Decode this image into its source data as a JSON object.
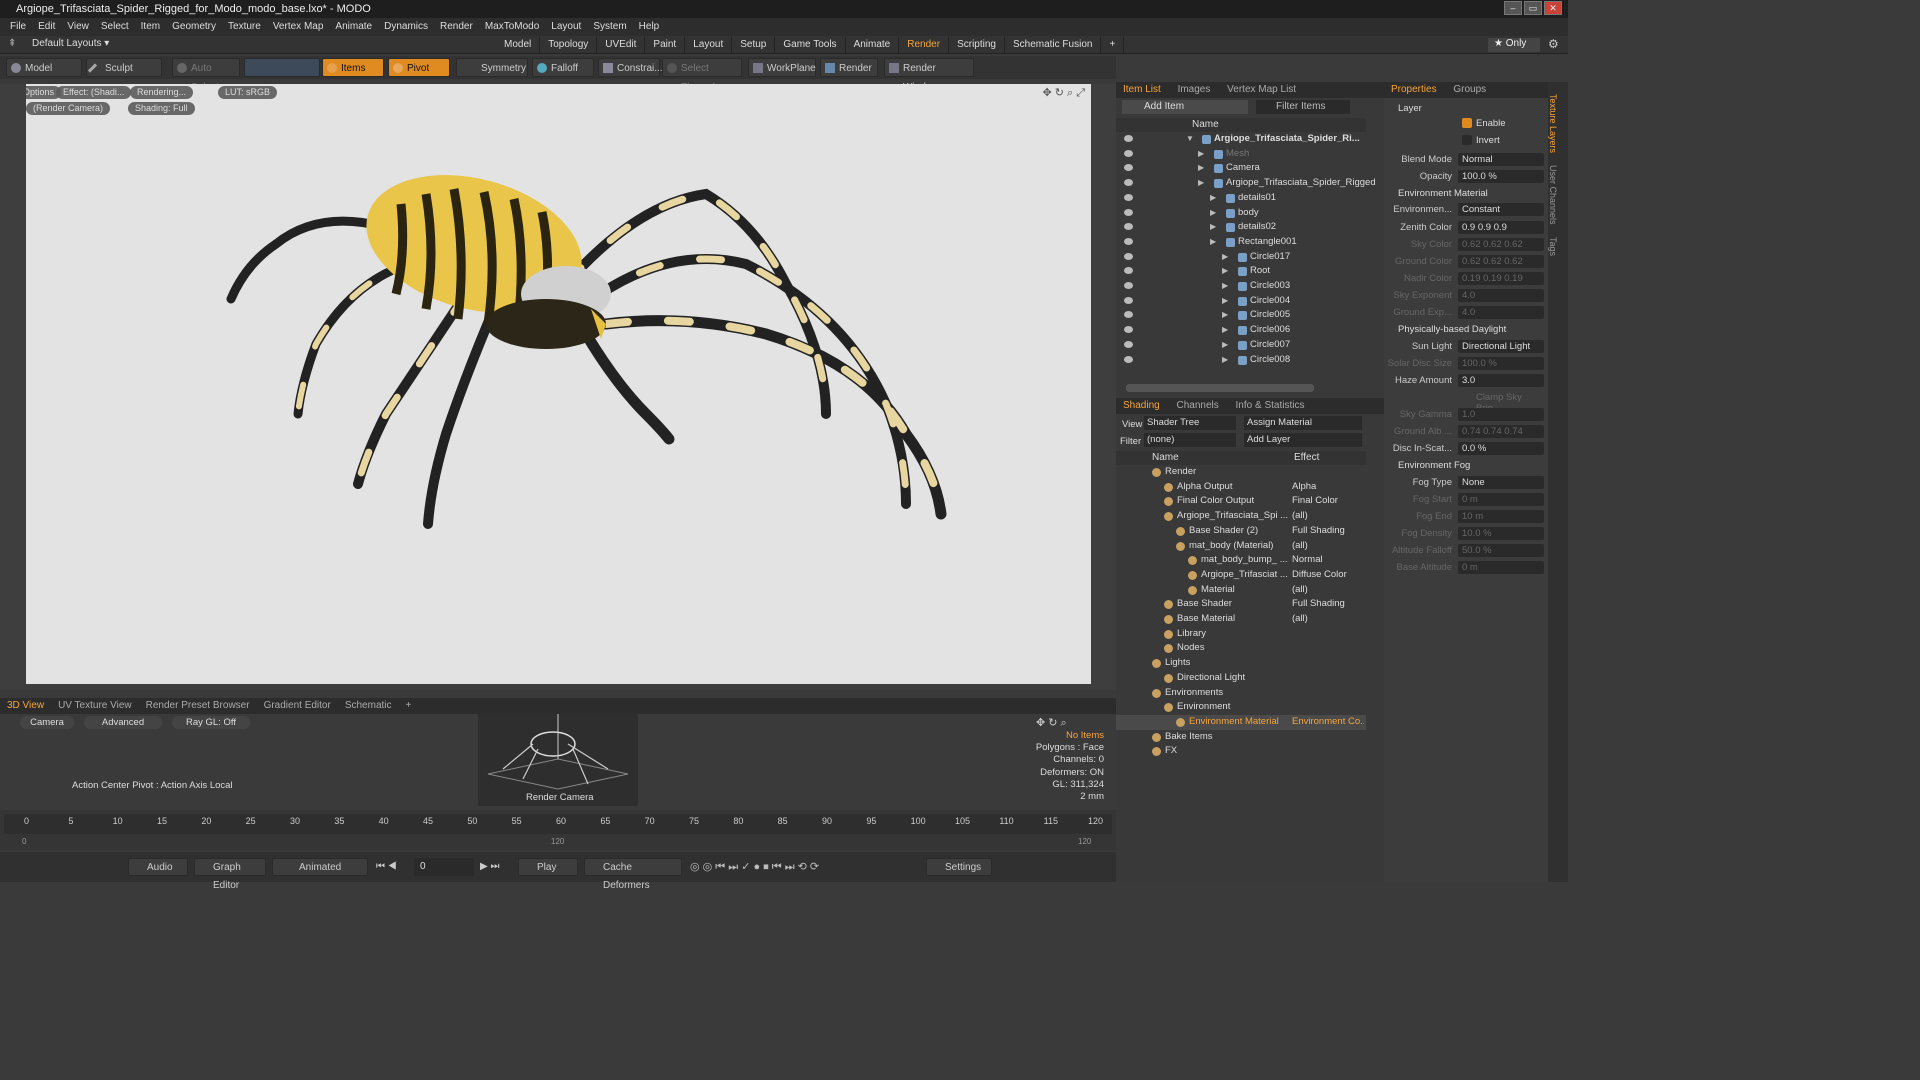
{
  "window": {
    "title": "Argiope_Trifasciata_Spider_Rigged_for_Modo_modo_base.lxo* - MODO"
  },
  "menu": [
    "File",
    "Edit",
    "View",
    "Select",
    "Item",
    "Geometry",
    "Texture",
    "Vertex Map",
    "Animate",
    "Dynamics",
    "Render",
    "MaxToModo",
    "Layout",
    "System",
    "Help"
  ],
  "layouts": {
    "dropdown": "Default Layouts ▾",
    "tabs": [
      "Model",
      "Topology",
      "UVEdit",
      "Paint",
      "Layout",
      "Setup",
      "Game Tools",
      "Animate",
      "Render",
      "Scripting",
      "Schematic Fusion"
    ],
    "active_tab": "Render",
    "only_label": "★ Only"
  },
  "toolbar": {
    "model": "Model",
    "sculpt": "Sculpt",
    "auto_select": "Auto Select",
    "items": "Items",
    "pivot": "Pivot",
    "symmetry": "Symmetry",
    "falloff": "Falloff",
    "constrain": "Constrai...",
    "select_through": "Select Through",
    "workplane": "WorkPlane",
    "render": "Render",
    "render_window": "Render Window"
  },
  "viewport": {
    "options": "Options",
    "effect": "Effect: (Shadi...",
    "rendering": "Rendering...",
    "lut": "LUT: sRGB",
    "camera": "(Render Camera)",
    "shading": "Shading: Full"
  },
  "item_list": {
    "tabs": [
      "Item List",
      "Images",
      "Vertex Map List"
    ],
    "add_item": "Add Item",
    "filter": "Filter Items",
    "col_name": "Name",
    "rows": [
      {
        "label": "Argiope_Trifasciata_Spider_Ri...",
        "indent": 0
      },
      {
        "label": "Mesh",
        "indent": 1
      },
      {
        "label": "Camera",
        "indent": 1
      },
      {
        "label": "Argiope_Trifasciata_Spider_Rigged",
        "indent": 1
      },
      {
        "label": "details01",
        "indent": 2
      },
      {
        "label": "body",
        "indent": 2
      },
      {
        "label": "details02",
        "indent": 2
      },
      {
        "label": "Rectangle001",
        "indent": 2
      },
      {
        "label": "Circle017",
        "indent": 3
      },
      {
        "label": "Root",
        "indent": 3
      },
      {
        "label": "Circle003",
        "indent": 3
      },
      {
        "label": "Circle004",
        "indent": 3
      },
      {
        "label": "Circle005",
        "indent": 3
      },
      {
        "label": "Circle006",
        "indent": 3
      },
      {
        "label": "Circle007",
        "indent": 3
      },
      {
        "label": "Circle008",
        "indent": 3
      }
    ]
  },
  "shading": {
    "tabs": [
      "Shading",
      "Channels",
      "Info & Statistics"
    ],
    "view_label": "View",
    "view_value": "Shader Tree",
    "assign": "Assign Material",
    "filter_label": "Filter",
    "filter_value": "(none)",
    "add_layer": "Add Layer",
    "col_name": "Name",
    "col_effect": "Effect",
    "rows": [
      {
        "label": "Render",
        "effect": "",
        "indent": 0
      },
      {
        "label": "Alpha Output",
        "effect": "Alpha",
        "indent": 1
      },
      {
        "label": "Final Color Output",
        "effect": "Final Color",
        "indent": 1
      },
      {
        "label": "Argiope_Trifasciata_Spi ...",
        "effect": "(all)",
        "indent": 1
      },
      {
        "label": "Base Shader (2)",
        "effect": "Full Shading",
        "indent": 2
      },
      {
        "label": "mat_body (Material)",
        "effect": "(all)",
        "indent": 2
      },
      {
        "label": "mat_body_bump_ ...",
        "effect": "Normal",
        "indent": 3
      },
      {
        "label": "Argiope_Trifasciat ...",
        "effect": "Diffuse Color",
        "indent": 3
      },
      {
        "label": "Material",
        "effect": "(all)",
        "indent": 3
      },
      {
        "label": "Base Shader",
        "effect": "Full Shading",
        "indent": 1
      },
      {
        "label": "Base Material",
        "effect": "(all)",
        "indent": 1
      },
      {
        "label": "Library",
        "effect": "",
        "indent": 1
      },
      {
        "label": "Nodes",
        "effect": "",
        "indent": 1
      },
      {
        "label": "Lights",
        "effect": "",
        "indent": 0
      },
      {
        "label": "Directional Light",
        "effect": "",
        "indent": 1
      },
      {
        "label": "Environments",
        "effect": "",
        "indent": 0
      },
      {
        "label": "Environment",
        "effect": "",
        "indent": 1
      },
      {
        "label": "Environment Material",
        "effect": "Environment Co...",
        "indent": 2
      },
      {
        "label": "Bake Items",
        "effect": "",
        "indent": 0
      },
      {
        "label": "FX",
        "effect": "",
        "indent": 0
      }
    ]
  },
  "properties": {
    "tabs": [
      "Properties",
      "Groups"
    ],
    "layer": "Layer",
    "enable": "Enable",
    "invert": "Invert",
    "env_material": "Environment Material",
    "daylight": "Physically-based Daylight",
    "fog": "Environment Fog",
    "clamp": "Clamp Sky Brig...",
    "rows": [
      {
        "label": "Blend Mode",
        "value": "Normal",
        "dim": false
      },
      {
        "label": "Opacity",
        "value": "100.0 %",
        "dim": false
      },
      {
        "label": "Environmen...",
        "value": "Constant",
        "dim": false
      },
      {
        "label": "Zenith Color",
        "value": "0.9   0.9   0.9",
        "dim": false
      },
      {
        "label": "Sky Color",
        "value": "0.62  0.62  0.62",
        "dim": true
      },
      {
        "label": "Ground Color",
        "value": "0.62  0.62  0.62",
        "dim": true
      },
      {
        "label": "Nadir Color",
        "value": "0.19  0.19  0.19",
        "dim": true
      },
      {
        "label": "Sky Exponent",
        "value": "4.0",
        "dim": true
      },
      {
        "label": "Ground Exp...",
        "value": "4.0",
        "dim": true
      },
      {
        "label": "Sun Light",
        "value": "Directional Light",
        "dim": false
      },
      {
        "label": "Solar Disc Size",
        "value": "100.0 %",
        "dim": true
      },
      {
        "label": "Haze Amount",
        "value": "3.0",
        "dim": false
      },
      {
        "label": "Sky Gamma",
        "value": "1.0",
        "dim": true
      },
      {
        "label": "Ground Alb ...",
        "value": "0.74  0.74  0.74",
        "dim": true
      },
      {
        "label": "Disc In-Scat...",
        "value": "0.0 %",
        "dim": false
      },
      {
        "label": "Fog Type",
        "value": "None",
        "dim": false
      },
      {
        "label": "Fog Start",
        "value": "0 m",
        "dim": true
      },
      {
        "label": "Fog End",
        "value": "10 m",
        "dim": true
      },
      {
        "label": "Fog Density",
        "value": "10.0 %",
        "dim": true
      },
      {
        "label": "Altitude Falloff",
        "value": "50.0 %",
        "dim": true
      },
      {
        "label": "Base Altitude",
        "value": "0 m",
        "dim": true
      }
    ]
  },
  "side_tabs": [
    "Texture Layers",
    "User Channels",
    "Tags"
  ],
  "bottom": {
    "tabs": [
      "3D View",
      "UV Texture View",
      "Render Preset Browser",
      "Gradient Editor",
      "Schematic"
    ],
    "camera": "Camera",
    "advanced": "Advanced",
    "raygl": "Ray GL: Off",
    "action_center": "Action Center Pivot : Action Axis Local",
    "render_camera": "Render Camera",
    "stats": [
      "No Items",
      "Polygons : Face",
      "Channels: 0",
      "Deformers: ON",
      "GL: 311,324",
      "2 mm"
    ]
  },
  "timeline": {
    "ticks": [
      "0",
      "5",
      "10",
      "15",
      "20",
      "25",
      "30",
      "35",
      "40",
      "45",
      "50",
      "55",
      "60",
      "65",
      "70",
      "75",
      "80",
      "85",
      "90",
      "95",
      "100",
      "105",
      "110",
      "115",
      "120"
    ],
    "sub_ticks": [
      "0",
      "120",
      "120"
    ]
  },
  "transport": {
    "audio": "Audio",
    "graph_editor": "Graph Editor",
    "animated": "Animated",
    "frame": "0",
    "play": "Play",
    "cache": "Cache Deformers",
    "settings": "Settings"
  }
}
